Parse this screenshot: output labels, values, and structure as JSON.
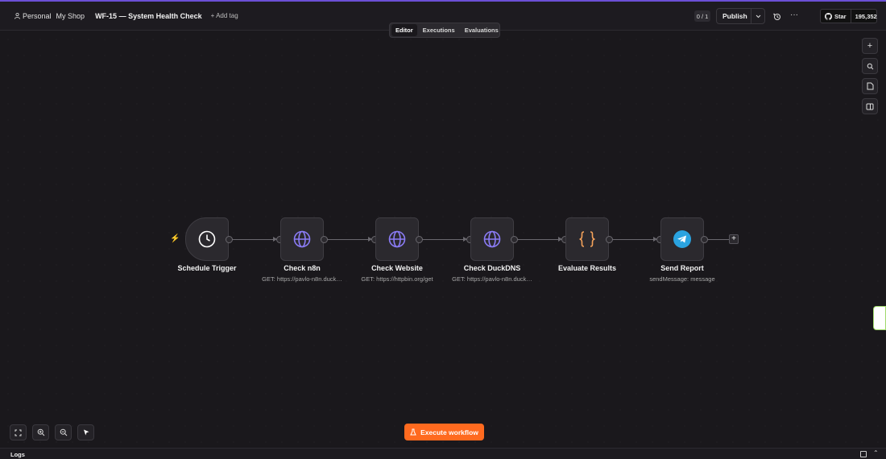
{
  "header": {
    "personal_label": "Personal",
    "separator": "/",
    "shop_label": "My Shop",
    "workflow_title": "WF-15 — System Health Check",
    "add_tag_label": "+ Add tag",
    "count_badge": "0 / 1",
    "publish_label": "Publish",
    "github_star_label": "Star",
    "github_star_count": "195,352"
  },
  "tabs": [
    {
      "label": "Editor",
      "active": true
    },
    {
      "label": "Executions",
      "active": false
    },
    {
      "label": "Evaluations",
      "active": false
    }
  ],
  "nodes": [
    {
      "title": "Schedule Trigger",
      "subtitle": "",
      "icon": "clock-icon"
    },
    {
      "title": "Check n8n",
      "subtitle": "GET: https://pavlo-n8n.duck…",
      "icon": "globe-icon"
    },
    {
      "title": "Check Website",
      "subtitle": "GET: https://httpbin.org/get",
      "icon": "globe-icon"
    },
    {
      "title": "Check DuckDNS",
      "subtitle": "GET: https://pavlo-n8n.duck…",
      "icon": "globe-icon"
    },
    {
      "title": "Evaluate Results",
      "subtitle": "",
      "icon": "code-braces-icon"
    },
    {
      "title": "Send Report",
      "subtitle": "sendMessage: message",
      "icon": "telegram-icon"
    }
  ],
  "execute_button_label": "Execute workflow",
  "logs_label": "Logs",
  "colors": {
    "accent": "#ff6a1f",
    "globe": "#8b7cf6",
    "braces": "#f6a35b",
    "telegram": "#2aa3e0",
    "background": "#1a181c"
  }
}
